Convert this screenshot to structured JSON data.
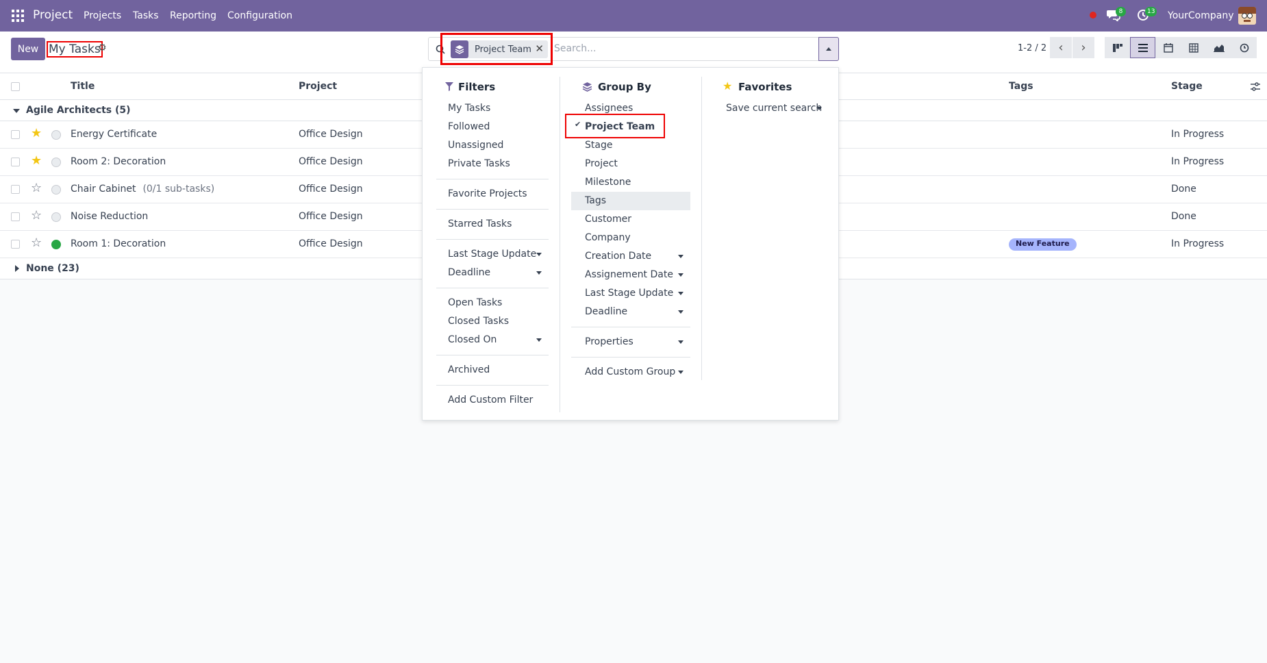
{
  "nav": {
    "brand": "Project",
    "menus": [
      "Projects",
      "Tasks",
      "Reporting",
      "Configuration"
    ],
    "messages_count": "8",
    "activities_count": "13",
    "company": "YourCompany"
  },
  "control": {
    "new_label": "New",
    "breadcrumb": "My Tasks",
    "facet_label": "Project Team",
    "search_placeholder": "Search...",
    "pager": "1-2 / 2"
  },
  "list": {
    "headers": {
      "title": "Title",
      "project": "Project",
      "tags": "Tags",
      "stage": "Stage"
    },
    "group1": "Agile Architects (5)",
    "group2": "None (23)",
    "rows": [
      {
        "title": "Energy Certificate",
        "subtask": "",
        "project": "Office Design",
        "tag": "",
        "stage": "In Progress",
        "starred": true,
        "status": "grey"
      },
      {
        "title": "Room 2: Decoration",
        "subtask": "",
        "project": "Office Design",
        "tag": "",
        "stage": "In Progress",
        "starred": true,
        "status": "grey"
      },
      {
        "title": "Chair Cabinet",
        "subtask": "(0/1 sub-tasks)",
        "project": "Office Design",
        "tag": "",
        "stage": "Done",
        "starred": false,
        "status": "grey"
      },
      {
        "title": "Noise Reduction",
        "subtask": "",
        "project": "Office Design",
        "tag": "",
        "stage": "Done",
        "starred": false,
        "status": "grey"
      },
      {
        "title": "Room 1: Decoration",
        "subtask": "",
        "project": "Office Design",
        "tag": "New Feature",
        "stage": "In Progress",
        "starred": false,
        "status": "green"
      }
    ]
  },
  "dropdown": {
    "filters": {
      "title": "Filters",
      "items": [
        "My Tasks",
        "Followed",
        "Unassigned",
        "Private Tasks",
        "Favorite Projects",
        "Starred Tasks",
        "Last Stage Update",
        "Deadline",
        "Open Tasks",
        "Closed Tasks",
        "Closed On",
        "Archived",
        "Add Custom Filter"
      ]
    },
    "groupby": {
      "title": "Group By",
      "items": [
        "Assignees",
        "Project Team",
        "Stage",
        "Project",
        "Milestone",
        "Tags",
        "Customer",
        "Company",
        "Creation Date",
        "Assignement Date",
        "Last Stage Update",
        "Deadline",
        "Properties",
        "Add Custom Group"
      ]
    },
    "favorites": {
      "title": "Favorites",
      "save": "Save current search"
    }
  },
  "colors": {
    "brand": "#71639e",
    "highlight": "#e00000",
    "success": "#28a745"
  }
}
